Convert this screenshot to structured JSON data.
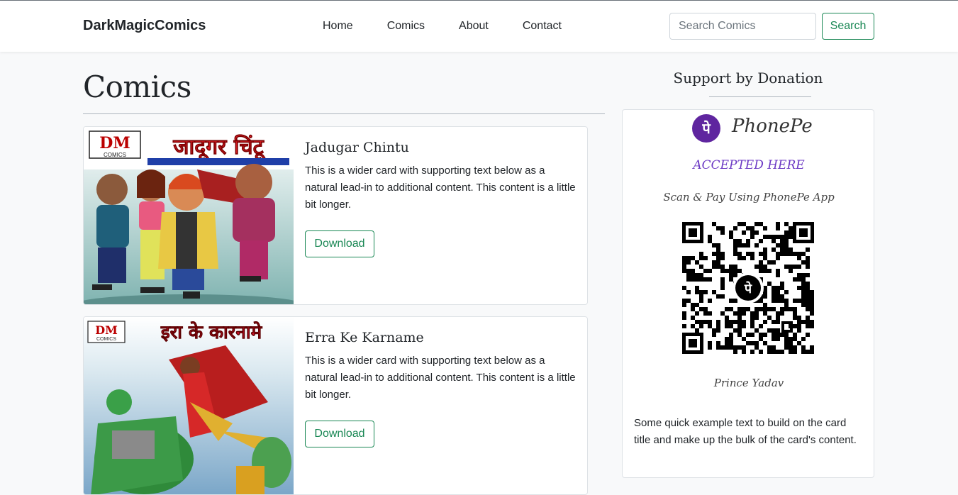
{
  "navbar": {
    "brand": "DarkMagicComics",
    "links": [
      "Home",
      "Comics",
      "About",
      "Contact"
    ],
    "search_placeholder": "Search Comics",
    "search_label": "Search"
  },
  "main": {
    "title": "Comics",
    "cards": [
      {
        "title": "Jadugar Chintu",
        "text": "This is a wider card with supporting text below as a natural lead-in to additional content. This content is a little bit longer.",
        "button": "Download",
        "cover_badge": "DM",
        "cover_badge_sub": "COMICS",
        "cover_title": "जादूगर चिंटू"
      },
      {
        "title": "Erra Ke Karname",
        "text": "This is a wider card with supporting text below as a natural lead-in to additional content. This content is a little bit longer.",
        "button": "Download",
        "cover_badge": "DM",
        "cover_badge_sub": "COMICS",
        "cover_title": "इरा के कारनामे"
      }
    ]
  },
  "sidebar": {
    "title": "Support by Donation",
    "brand": "PhonePe",
    "brand_mark": "पे",
    "accepted": "ACCEPTED HERE",
    "scan": "Scan & Pay Using PhonePe App",
    "person": "Prince Yadav",
    "text": "Some quick example text to build on the card title and make up the bulk of the card's content."
  },
  "colors": {
    "accent": "#198754",
    "phonepe": "#5f259f"
  }
}
